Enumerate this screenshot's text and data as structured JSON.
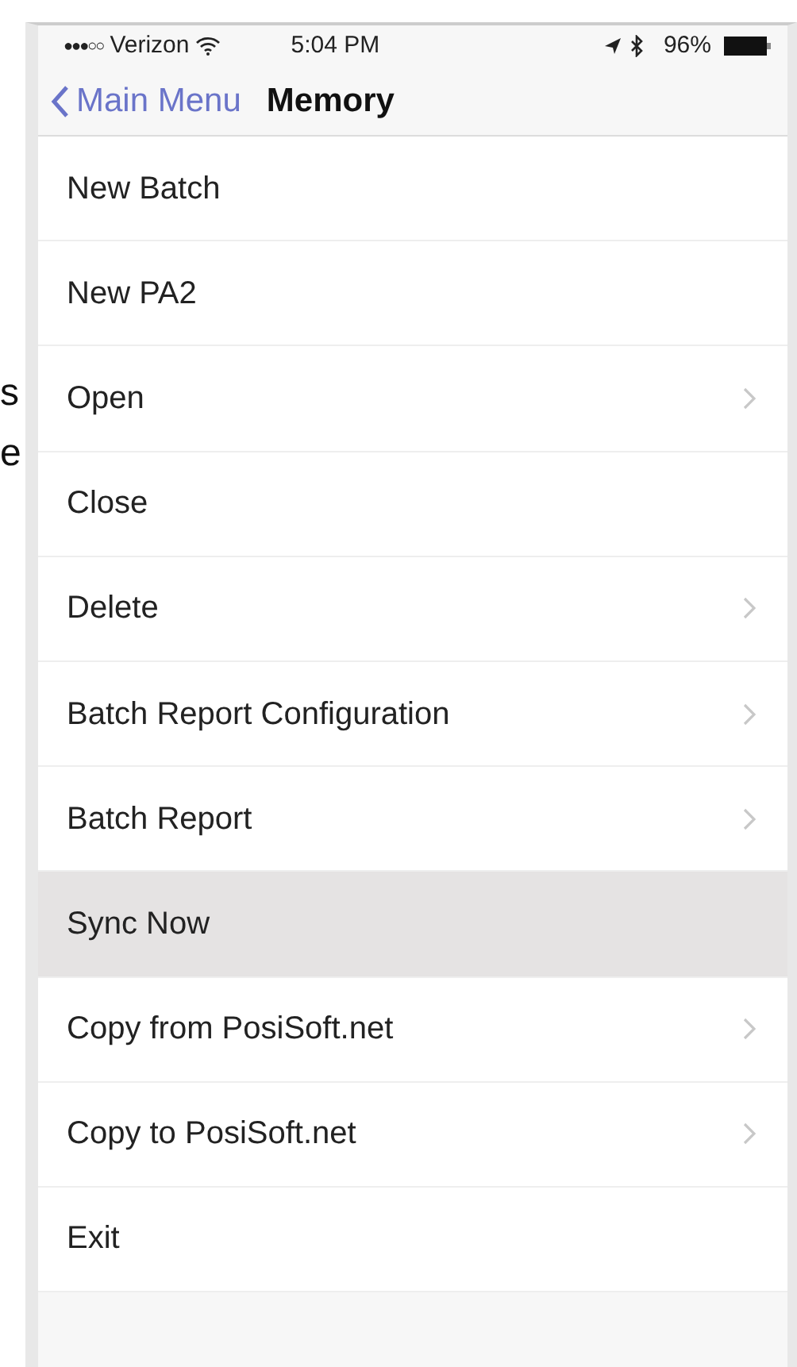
{
  "side_text": [
    "s",
    "e"
  ],
  "status_bar": {
    "signal_dots": "●●●○○",
    "carrier": "Verizon",
    "time": "5:04 PM",
    "battery": "96%"
  },
  "nav_bar": {
    "back": "Main Menu",
    "title": "Memory"
  },
  "menu": [
    {
      "label": "New Batch",
      "chevron": false,
      "selected": false
    },
    {
      "label": "New PA2",
      "chevron": false,
      "selected": false
    },
    {
      "label": "Open",
      "chevron": true,
      "selected": false
    },
    {
      "label": "Close",
      "chevron": false,
      "selected": false
    },
    {
      "label": "Delete",
      "chevron": true,
      "selected": false
    },
    {
      "label": "Batch Report Configuration",
      "chevron": true,
      "selected": false
    },
    {
      "label": "Batch Report",
      "chevron": true,
      "selected": false
    },
    {
      "label": "Sync Now",
      "chevron": false,
      "selected": true
    },
    {
      "label": "Copy from PosiSoft.net",
      "chevron": true,
      "selected": false
    },
    {
      "label": "Copy to PosiSoft.net",
      "chevron": true,
      "selected": false
    },
    {
      "label": "Exit",
      "chevron": false,
      "selected": false
    }
  ]
}
